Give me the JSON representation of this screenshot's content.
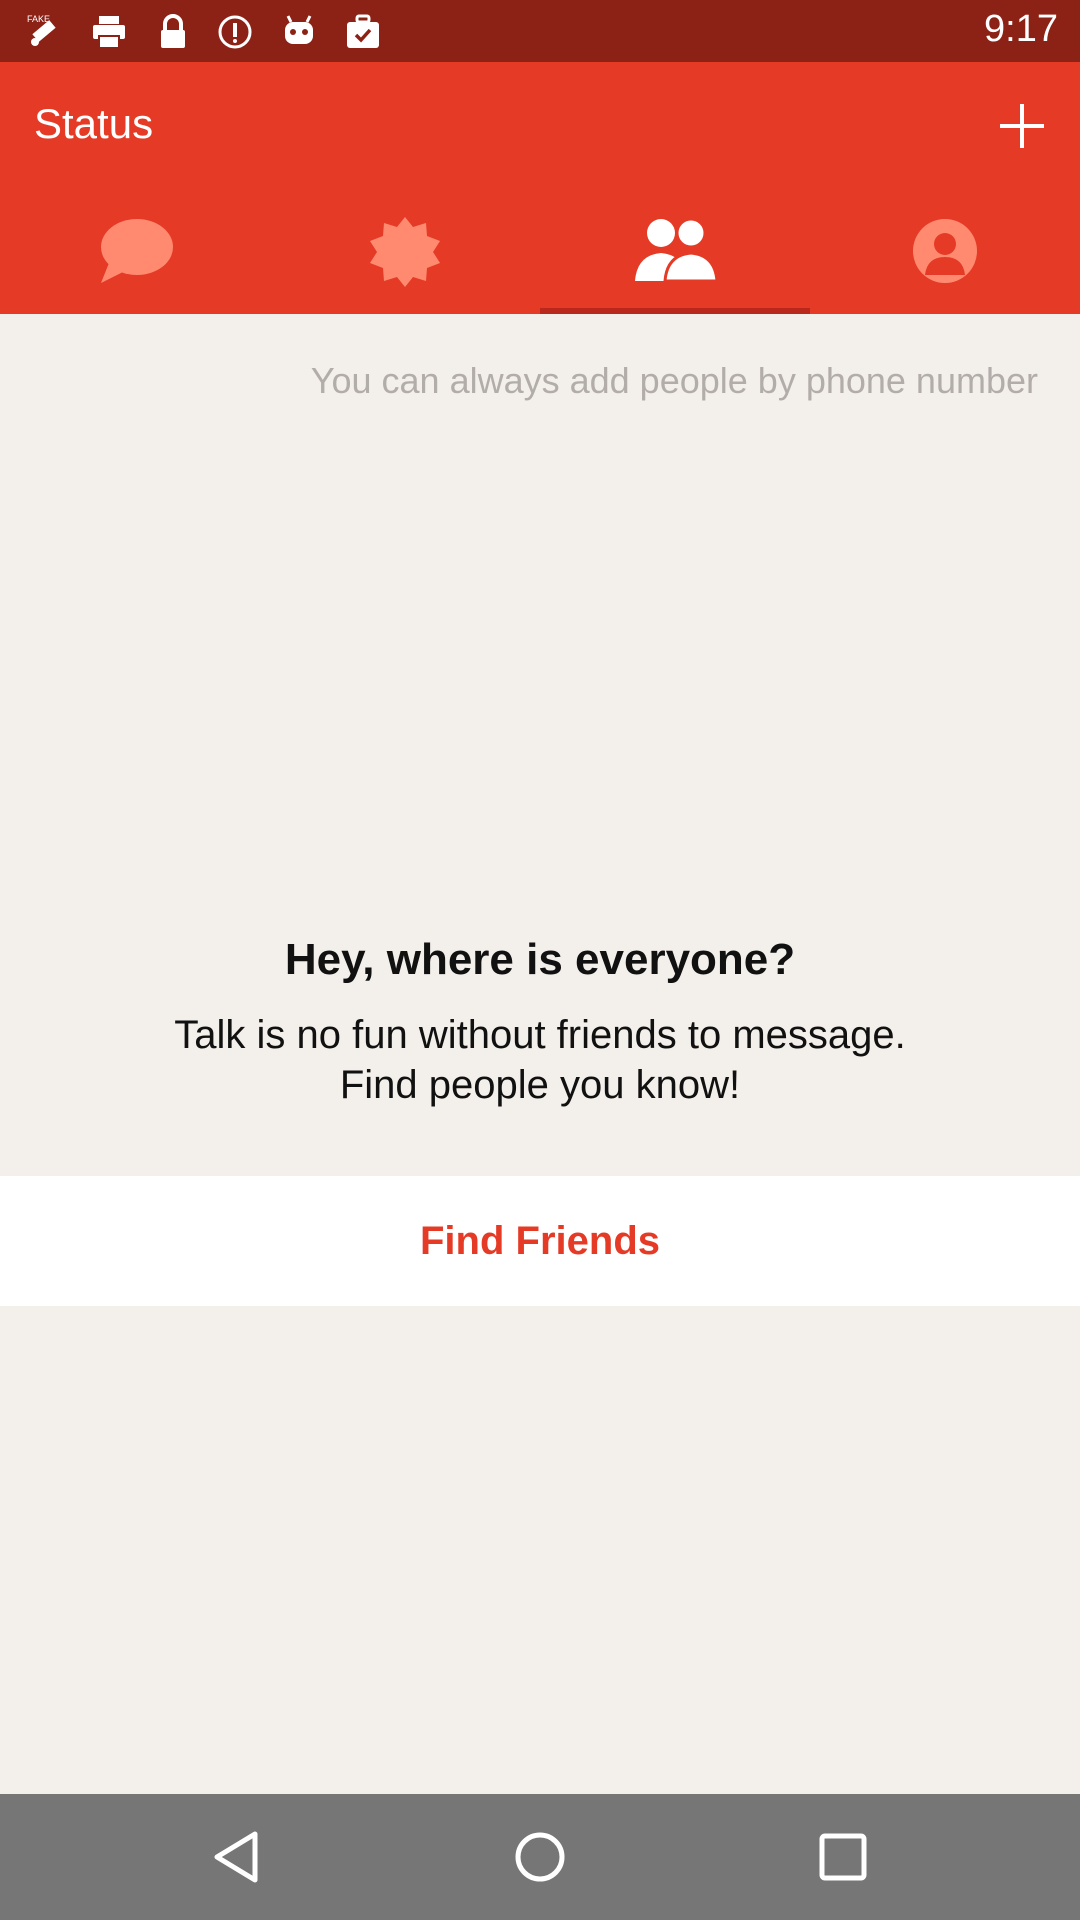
{
  "status_bar": {
    "time": "9:17",
    "icons": [
      "fake-gps-icon",
      "printer-icon",
      "lock-icon",
      "info-icon",
      "android-icon",
      "briefcase-check-icon"
    ]
  },
  "app_bar": {
    "title": "Status",
    "add_icon": "plus-icon"
  },
  "tabs": [
    {
      "icon": "chat-bubble-icon",
      "selected": false
    },
    {
      "icon": "badge-icon",
      "selected": false
    },
    {
      "icon": "people-icon",
      "selected": true
    },
    {
      "icon": "person-icon",
      "selected": false
    }
  ],
  "content": {
    "hint": "You can always add people by phone number",
    "empty_title": "Hey, where is everyone?",
    "empty_line1": "Talk is no fun without friends to message.",
    "empty_line2": "Find people you know!",
    "find_friends_label": "Find Friends"
  },
  "nav_bar": {
    "icons": [
      "back-icon",
      "home-icon",
      "recents-icon"
    ]
  },
  "colors": {
    "status_bar": "#8c2116",
    "accent": "#e53b26",
    "tab_icon": "#ff8a70",
    "indicator": "#b9281a",
    "background": "#f3efeb",
    "nav_bar": "#767676"
  }
}
